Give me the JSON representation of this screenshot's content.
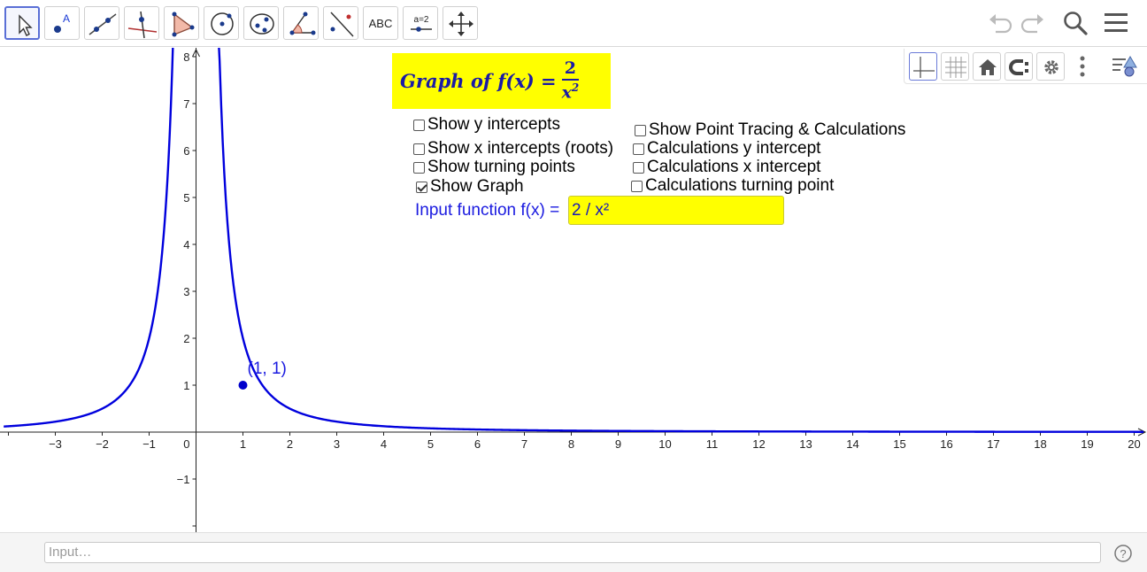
{
  "toolbar": {
    "tools": [
      {
        "name": "move-tool",
        "icon": "arrow-cursor-icon"
      },
      {
        "name": "point-tool",
        "icon": "point-icon",
        "label": "A"
      },
      {
        "name": "line-tool",
        "icon": "line-icon"
      },
      {
        "name": "perpendicular-tool",
        "icon": "perpendicular-icon"
      },
      {
        "name": "polygon-tool",
        "icon": "polygon-icon"
      },
      {
        "name": "circle-tool",
        "icon": "circle-icon"
      },
      {
        "name": "ellipse-tool",
        "icon": "ellipse-icon"
      },
      {
        "name": "angle-tool",
        "icon": "angle-icon"
      },
      {
        "name": "reflect-tool",
        "icon": "reflect-icon"
      },
      {
        "name": "text-tool",
        "icon": "text-icon",
        "label": "ABC"
      },
      {
        "name": "slider-tool",
        "icon": "slider-icon",
        "label": "a=2"
      },
      {
        "name": "move-view-tool",
        "icon": "move-view-icon"
      }
    ],
    "right_icons": [
      "undo-icon",
      "redo-icon",
      "search-icon",
      "menu-icon"
    ]
  },
  "stylebar": {
    "buttons": [
      "axes-icon",
      "grid-icon",
      "home-icon",
      "point-capture-icon",
      "gear-icon",
      "more-icon",
      "graphics-view-icon"
    ]
  },
  "title": {
    "prefix": "Graph of f(x) =",
    "numerator": "2",
    "denominator": "x",
    "exponent": "2"
  },
  "checkboxes": {
    "show_y_intercepts": {
      "label": "Show y intercepts",
      "checked": false
    },
    "show_x_intercepts": {
      "label": "Show x intercepts (roots)",
      "checked": false
    },
    "show_turning_points": {
      "label": "Show turning points",
      "checked": false
    },
    "show_graph": {
      "label": "Show Graph",
      "checked": true
    },
    "show_point_tracing": {
      "label": "Show Point Tracing & Calculations",
      "checked": false
    },
    "calc_y_intercept": {
      "label": "Calculations y intercept",
      "checked": false
    },
    "calc_x_intercept": {
      "label": "Calculations x intercept",
      "checked": false
    },
    "calc_turning_point": {
      "label": "Calculations turning point",
      "checked": false
    }
  },
  "input_function": {
    "label": "Input function f(x) =",
    "value": "2 / x²"
  },
  "point": {
    "x": 1,
    "y": 1,
    "label": "(1, 1)"
  },
  "chart_data": {
    "type": "line",
    "function": "2/x^2",
    "xlim": [
      -4.1,
      20.2
    ],
    "ylim": [
      -2.1,
      8.1
    ],
    "x_ticks": [
      "-3",
      "-2",
      "-1",
      "1",
      "2",
      "3",
      "4",
      "5",
      "6",
      "7",
      "8",
      "9",
      "10",
      "11",
      "12",
      "13",
      "14",
      "15",
      "16",
      "17",
      "18",
      "19",
      "20"
    ],
    "y_ticks": [
      "8",
      "7",
      "6",
      "5",
      "4",
      "3",
      "2",
      "1",
      "-1"
    ],
    "origin_label": "0",
    "curve_color": "#0000dd",
    "grid": false
  },
  "input_bar": {
    "placeholder": "Input…"
  },
  "colors": {
    "accent": "#5a6fd6",
    "curve": "#0000dd",
    "highlight": "#ffff00",
    "label_blue": "#1a1ae0"
  }
}
